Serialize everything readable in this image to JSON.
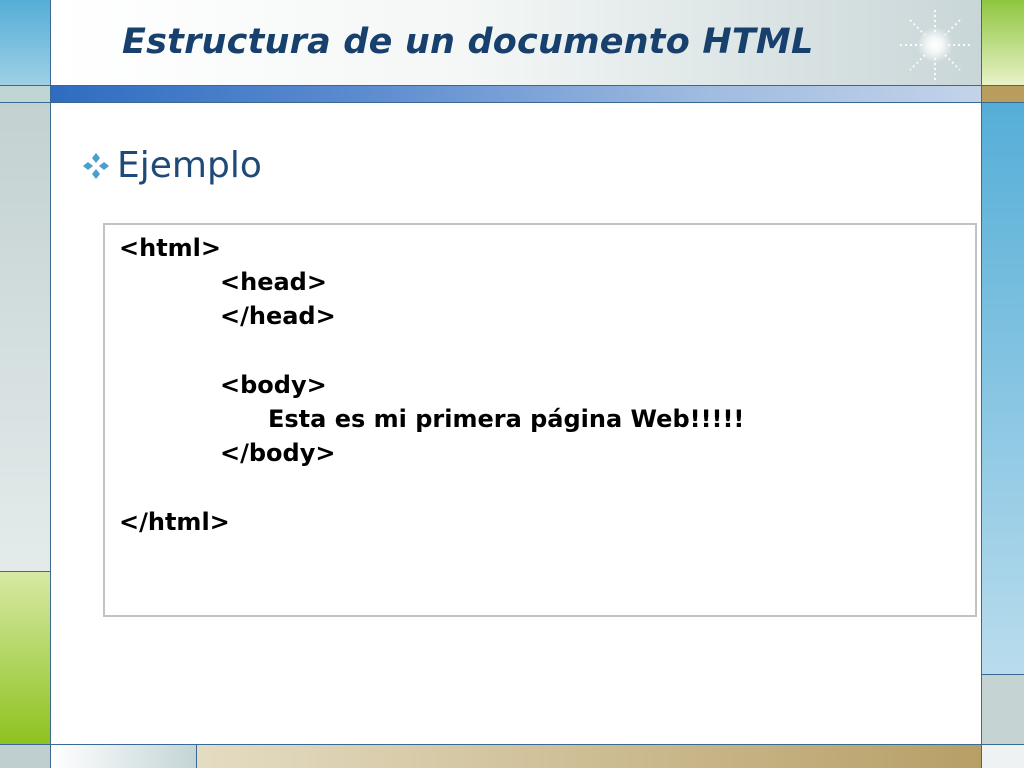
{
  "slide": {
    "title": "Estructura de un documento HTML",
    "bullet": {
      "icon": "diamond-bullet-icon",
      "text": "Ejemplo"
    },
    "code_lines": [
      "<html>",
      "<head>",
      "</head>",
      "<body>",
      "Esta es mi primera página Web!!!!!",
      "</body>",
      "</html>"
    ]
  },
  "colors": {
    "title": "#17406d",
    "bullet_text": "#1f4a78",
    "bullet_icon": "#4a9fd0",
    "accent_blue": "#2f6cc0",
    "accent_green": "#8dc21f",
    "accent_tan": "#b79f66"
  },
  "decorations": {
    "title_ornament": "sparkle-icon"
  }
}
